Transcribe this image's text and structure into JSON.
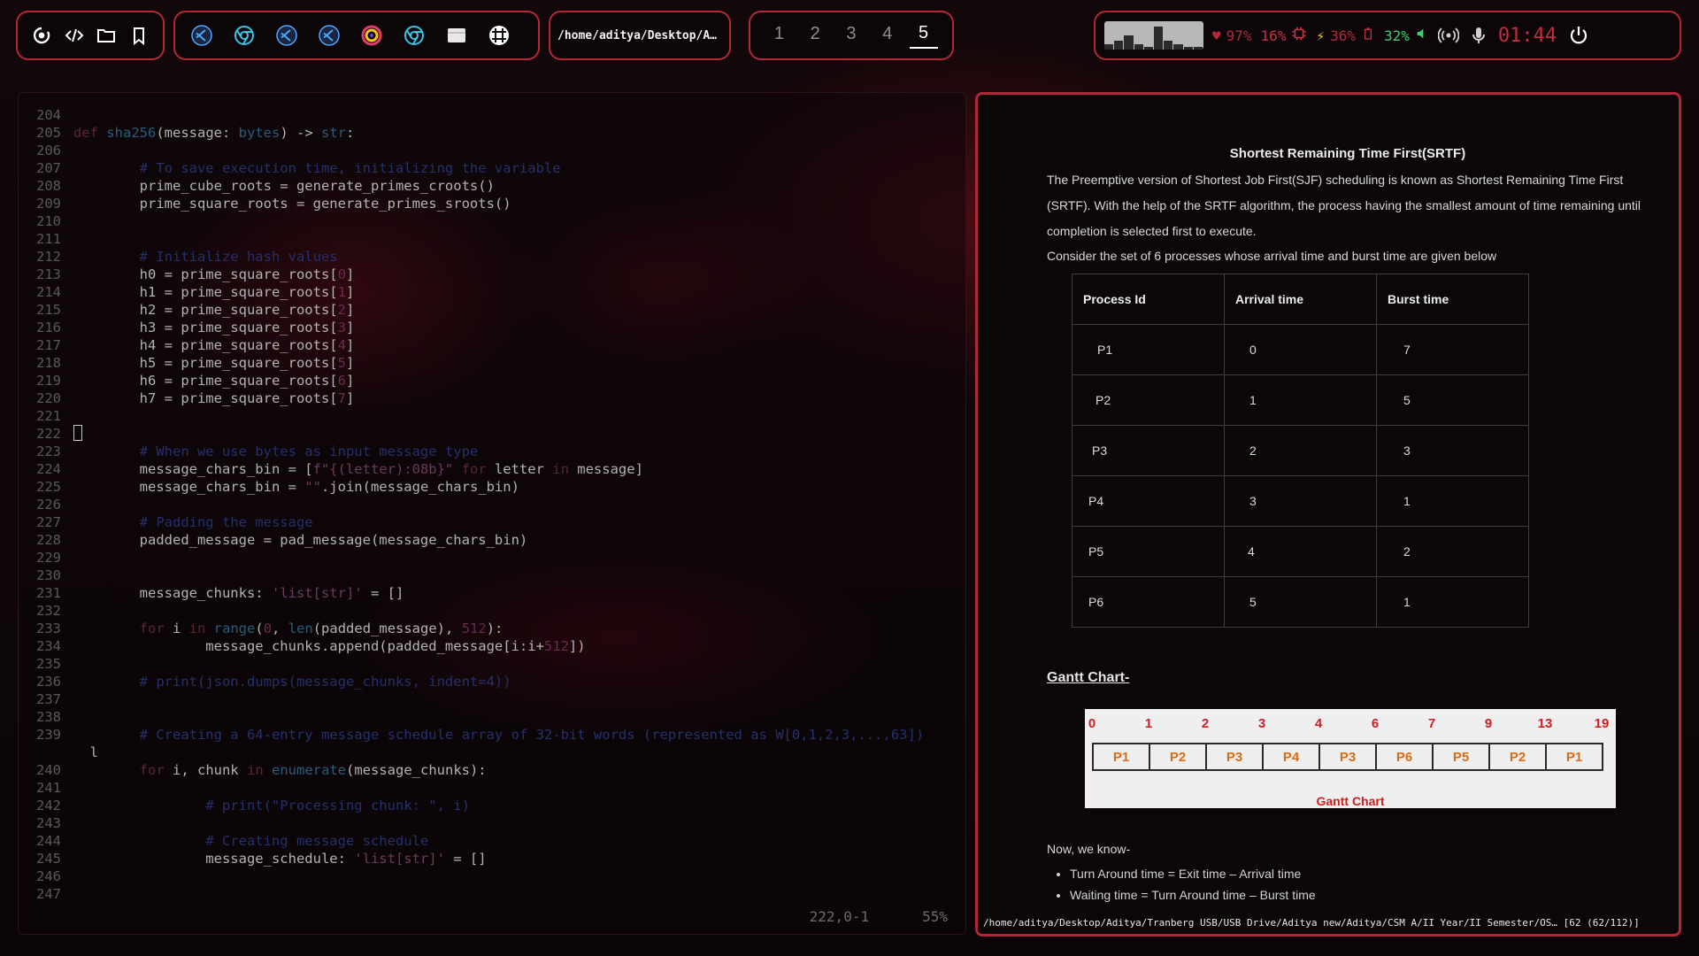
{
  "topbar": {
    "launcher_icons": [
      "power-menu-icon",
      "code-icon",
      "folder-icon",
      "bookmark-icon"
    ],
    "app_icons": [
      "vscode-icon",
      "chrome-icon",
      "vscode-icon",
      "vscode-icon",
      "color-picker-icon",
      "chrome-icon",
      "notes-icon",
      "grid-icon"
    ],
    "path": "/home/aditya/Desktop/A…",
    "workspaces": [
      "1",
      "2",
      "3",
      "4",
      "5"
    ],
    "active_workspace": "5",
    "system": {
      "cpu_graph": [
        2,
        3,
        5,
        2,
        1,
        8,
        3,
        2,
        1,
        1
      ],
      "battery_health": "97%",
      "cpu": "16%",
      "power": "36%",
      "volume": "32%",
      "clock": "01:44"
    }
  },
  "editor": {
    "cursor_pos": "222,0-1",
    "scroll_percent": "55%",
    "lines": [
      {
        "n": "204",
        "text": ""
      },
      {
        "n": "205",
        "text": "def sha256(message: bytes) -> str:"
      },
      {
        "n": "206",
        "text": ""
      },
      {
        "n": "207",
        "text": "        # To save execution time, initializing the variable"
      },
      {
        "n": "208",
        "text": "        prime_cube_roots = generate_primes_croots()"
      },
      {
        "n": "209",
        "text": "        prime_square_roots = generate_primes_sroots()"
      },
      {
        "n": "210",
        "text": ""
      },
      {
        "n": "211",
        "text": ""
      },
      {
        "n": "212",
        "text": "        # Initialize hash values"
      },
      {
        "n": "213",
        "text": "        h0 = prime_square_roots[0]"
      },
      {
        "n": "214",
        "text": "        h1 = prime_square_roots[1]"
      },
      {
        "n": "215",
        "text": "        h2 = prime_square_roots[2]"
      },
      {
        "n": "216",
        "text": "        h3 = prime_square_roots[3]"
      },
      {
        "n": "217",
        "text": "        h4 = prime_square_roots[4]"
      },
      {
        "n": "218",
        "text": "        h5 = prime_square_roots[5]"
      },
      {
        "n": "219",
        "text": "        h6 = prime_square_roots[6]"
      },
      {
        "n": "220",
        "text": "        h7 = prime_square_roots[7]"
      },
      {
        "n": "221",
        "text": ""
      },
      {
        "n": "222",
        "text": ""
      },
      {
        "n": "223",
        "text": "        # When we use bytes as input message type"
      },
      {
        "n": "224",
        "text": "        message_chars_bin = [f\"{(letter):08b}\" for letter in message]"
      },
      {
        "n": "225",
        "text": "        message_chars_bin = \"\".join(message_chars_bin)"
      },
      {
        "n": "226",
        "text": ""
      },
      {
        "n": "227",
        "text": "        # Padding the message"
      },
      {
        "n": "228",
        "text": "        padded_message = pad_message(message_chars_bin)"
      },
      {
        "n": "229",
        "text": ""
      },
      {
        "n": "230",
        "text": ""
      },
      {
        "n": "231",
        "text": "        message_chunks: 'list[str]' = []"
      },
      {
        "n": "232",
        "text": ""
      },
      {
        "n": "233",
        "text": "        for i in range(0, len(padded_message), 512):"
      },
      {
        "n": "234",
        "text": "                message_chunks.append(padded_message[i:i+512])"
      },
      {
        "n": "235",
        "text": ""
      },
      {
        "n": "236",
        "text": "        # print(json.dumps(message_chunks, indent=4))"
      },
      {
        "n": "237",
        "text": ""
      },
      {
        "n": "238",
        "text": ""
      },
      {
        "n": "239",
        "text": "        # Creating a 64-entry message schedule array of 32-bit words (represented as W[0,1,2,3,...,63])"
      },
      {
        "n": "",
        "text": "  l"
      },
      {
        "n": "240",
        "text": "        for i, chunk in enumerate(message_chunks):"
      },
      {
        "n": "241",
        "text": ""
      },
      {
        "n": "242",
        "text": "                # print(\"Processing chunk: \", i)"
      },
      {
        "n": "243",
        "text": ""
      },
      {
        "n": "244",
        "text": "                # Creating message schedule"
      },
      {
        "n": "245",
        "text": "                message_schedule: 'list[str]' = []"
      },
      {
        "n": "246",
        "text": ""
      },
      {
        "n": "247",
        "text": ""
      }
    ]
  },
  "viewer": {
    "title": "Shortest Remaining Time First(SRTF)",
    "para1": "The Preemptive version of Shortest Job First(SJF) scheduling is known as Shortest Remaining Time First (SRTF). With the help of the SRTF algorithm, the process having the smallest amount of time remaining until completion is selected first to execute.",
    "para2": "Consider the set of 6 processes whose arrival time and burst time are given below",
    "table": {
      "headers": [
        "Process Id",
        "Arrival time",
        "Burst time"
      ],
      "rows": [
        [
          "P1",
          "0",
          "7"
        ],
        [
          "P2",
          "1",
          "5"
        ],
        [
          "P3",
          "2",
          "3"
        ],
        [
          "P4",
          "3",
          "1"
        ],
        [
          "P5",
          "4",
          "2"
        ],
        [
          "P6",
          "5",
          "1"
        ]
      ]
    },
    "gantt_heading": "Gantt Chart-",
    "gantt": {
      "times": [
        "0",
        "1",
        "2",
        "3",
        "4",
        "6",
        "7",
        "9",
        "13",
        "19"
      ],
      "cells": [
        "P1",
        "P2",
        "P3",
        "P4",
        "P3",
        "P6",
        "P5",
        "P2",
        "P1"
      ],
      "caption": "Gantt Chart"
    },
    "now_we_know": "Now, we know-",
    "bullets": [
      "Turn Around time = Exit time – Arrival time",
      "Waiting time = Turn Around time – Burst time"
    ],
    "status": "/home/aditya/Desktop/Aditya/Tranberg USB/USB Drive/Aditya new/Aditya/CSM A/II Year/II Semester/OS… [62 (62/112)]"
  }
}
